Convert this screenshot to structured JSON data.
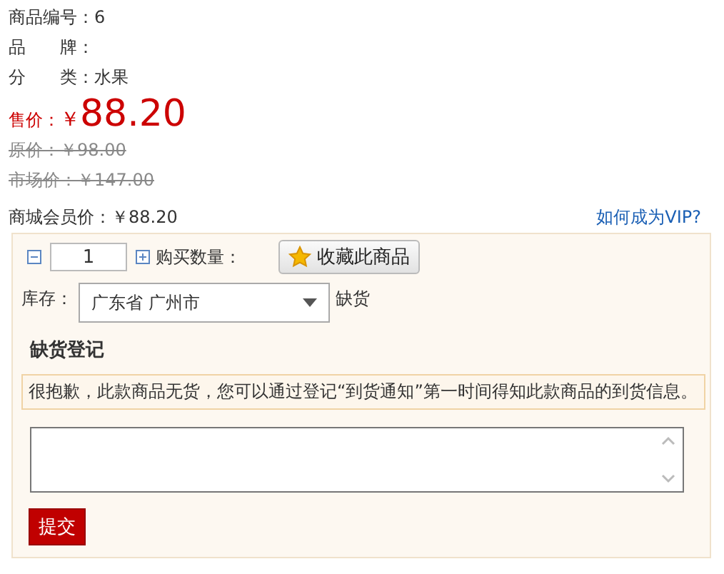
{
  "info_lines": [
    {
      "text": "商品编号：6"
    },
    {
      "text": "品　　牌："
    },
    {
      "text": "分　　类：水果"
    }
  ],
  "price": {
    "label": "售价：",
    "currency": "￥",
    "amount": "88.20"
  },
  "old_prices": [
    {
      "text": "原价：￥98.00",
      "struck": true
    },
    {
      "text": "市场价：￥147.00",
      "struck": true
    }
  ],
  "member_price": "商城会员价：￥88.20",
  "vip_link": "如何成为VIP?",
  "purchase": {
    "quantity": "1",
    "quantity_label": "购买数量：",
    "favorite_button": "收藏此商品"
  },
  "stock": {
    "label": "库存：",
    "region": "广东省 广州市",
    "status": "缺货"
  },
  "register": {
    "title": "缺货登记",
    "notice": "很抱歉，此款商品无货，您可以通过登记“到货通知”第一时间得知此款商品的到货信息。",
    "submit": "提交"
  }
}
